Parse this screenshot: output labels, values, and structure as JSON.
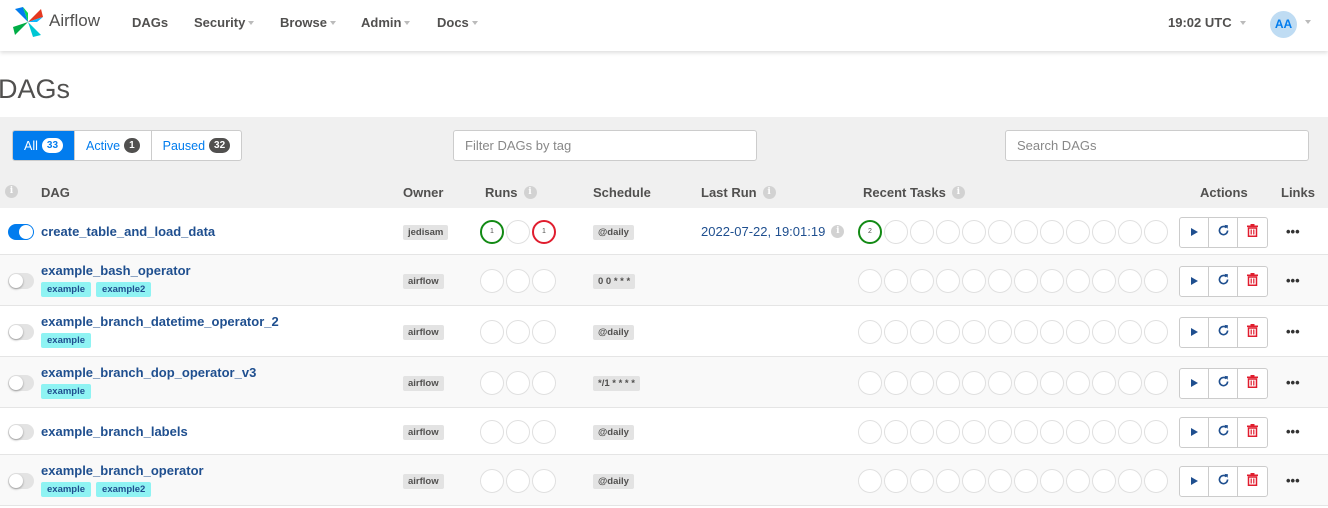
{
  "navbar": {
    "brand": "Airflow",
    "items": [
      "DAGs",
      "Security",
      "Browse",
      "Admin",
      "Docs"
    ],
    "time": "19:02 UTC",
    "user_initials": "AA"
  },
  "page": {
    "title": "DAGs"
  },
  "filters": {
    "all_label": "All",
    "all_count": "33",
    "active_label": "Active",
    "active_count": "1",
    "paused_label": "Paused",
    "paused_count": "32",
    "tag_placeholder": "Filter DAGs by tag",
    "search_placeholder": "Search DAGs"
  },
  "table": {
    "headers": {
      "dag": "DAG",
      "owner": "Owner",
      "runs": "Runs",
      "schedule": "Schedule",
      "last_run": "Last Run",
      "recent_tasks": "Recent Tasks",
      "actions": "Actions",
      "links": "Links"
    },
    "rows": [
      {
        "dag_id": "create_table_and_load_data",
        "tags": [],
        "owner": "jedisam",
        "schedule": "@daily",
        "last_run": "2022-07-22, 19:01:19",
        "active": true,
        "runs": [
          {
            "state": "success",
            "count": "1"
          },
          {
            "state": "none",
            "count": ""
          },
          {
            "state": "failed",
            "count": "1"
          }
        ],
        "recent_first": {
          "state": "success",
          "count": "2"
        }
      },
      {
        "dag_id": "example_bash_operator",
        "tags": [
          "example",
          "example2"
        ],
        "owner": "airflow",
        "schedule": "0 0 * * *",
        "last_run": "",
        "active": false,
        "runs": [],
        "recent_first": null
      },
      {
        "dag_id": "example_branch_datetime_operator_2",
        "tags": [
          "example"
        ],
        "owner": "airflow",
        "schedule": "@daily",
        "last_run": "",
        "active": false,
        "runs": [],
        "recent_first": null
      },
      {
        "dag_id": "example_branch_dop_operator_v3",
        "tags": [
          "example"
        ],
        "owner": "airflow",
        "schedule": "*/1 * * * *",
        "last_run": "",
        "active": false,
        "runs": [],
        "recent_first": null
      },
      {
        "dag_id": "example_branch_labels",
        "tags": [],
        "owner": "airflow",
        "schedule": "@daily",
        "last_run": "",
        "active": false,
        "runs": [],
        "recent_first": null
      },
      {
        "dag_id": "example_branch_operator",
        "tags": [
          "example",
          "example2"
        ],
        "owner": "airflow",
        "schedule": "@daily",
        "last_run": "",
        "active": false,
        "runs": [],
        "recent_first": null
      }
    ],
    "links_menu": "•••"
  },
  "icons": {
    "brand": "airflow-pinwheel-logo",
    "info": "info-icon",
    "trigger": "play-icon",
    "refresh": "refresh-icon",
    "delete": "trash-icon"
  },
  "colors": {
    "primary": "#017cee",
    "success": "#128a14",
    "failed": "#e01d2e",
    "tag": "#8ff3f3",
    "dag_link": "#1f4f8f"
  }
}
